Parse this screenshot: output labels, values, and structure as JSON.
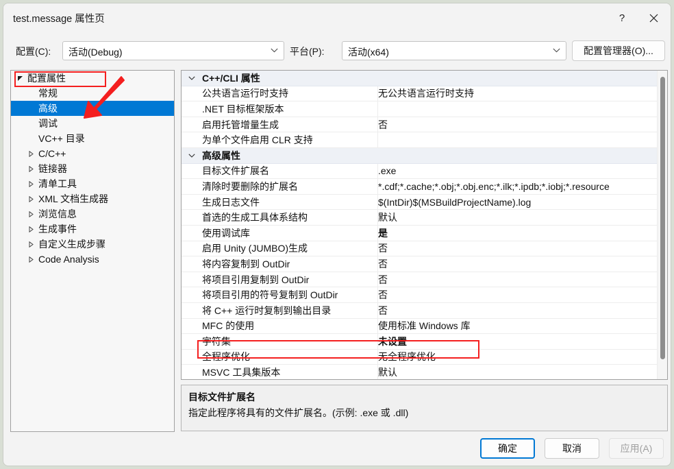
{
  "window": {
    "title": "test.message 属性页",
    "help_icon": "question-mark-icon",
    "close_icon": "close-icon"
  },
  "config_bar": {
    "config_label": "配置(C):",
    "config_value": "活动(Debug)",
    "platform_label": "平台(P):",
    "platform_value": "活动(x64)",
    "config_manager_button": "配置管理器(O)..."
  },
  "tree": {
    "items": [
      {
        "label": "配置属性",
        "depth": 0,
        "expander": "expanded",
        "selected": false
      },
      {
        "label": "常规",
        "depth": 1,
        "expander": "none",
        "selected": false
      },
      {
        "label": "高级",
        "depth": 1,
        "expander": "none",
        "selected": true
      },
      {
        "label": "调试",
        "depth": 1,
        "expander": "none",
        "selected": false
      },
      {
        "label": "VC++ 目录",
        "depth": 1,
        "expander": "none",
        "selected": false
      },
      {
        "label": "C/C++",
        "depth": 1,
        "expander": "collapsed",
        "selected": false
      },
      {
        "label": "链接器",
        "depth": 1,
        "expander": "collapsed",
        "selected": false
      },
      {
        "label": "清单工具",
        "depth": 1,
        "expander": "collapsed",
        "selected": false
      },
      {
        "label": "XML 文档生成器",
        "depth": 1,
        "expander": "collapsed",
        "selected": false
      },
      {
        "label": "浏览信息",
        "depth": 1,
        "expander": "collapsed",
        "selected": false
      },
      {
        "label": "生成事件",
        "depth": 1,
        "expander": "collapsed",
        "selected": false
      },
      {
        "label": "自定义生成步骤",
        "depth": 1,
        "expander": "collapsed",
        "selected": false
      },
      {
        "label": "Code Analysis",
        "depth": 1,
        "expander": "collapsed",
        "selected": false
      }
    ]
  },
  "grid": {
    "rows": [
      {
        "kind": "category",
        "name": "C++/CLI 属性",
        "value": "",
        "bold": false
      },
      {
        "kind": "property",
        "name": "公共语言运行时支持",
        "value": "无公共语言运行时支持",
        "bold": false
      },
      {
        "kind": "property",
        "name": ".NET 目标框架版本",
        "value": "",
        "bold": false
      },
      {
        "kind": "property",
        "name": "启用托管增量生成",
        "value": "否",
        "bold": false
      },
      {
        "kind": "property",
        "name": "为单个文件启用 CLR 支持",
        "value": "",
        "bold": false
      },
      {
        "kind": "category",
        "name": "高级属性",
        "value": "",
        "bold": false
      },
      {
        "kind": "property",
        "name": "目标文件扩展名",
        "value": ".exe",
        "bold": false
      },
      {
        "kind": "property",
        "name": "清除时要删除的扩展名",
        "value": "*.cdf;*.cache;*.obj;*.obj.enc;*.ilk;*.ipdb;*.iobj;*.resource",
        "bold": false
      },
      {
        "kind": "property",
        "name": "生成日志文件",
        "value": "$(IntDir)$(MSBuildProjectName).log",
        "bold": false
      },
      {
        "kind": "property",
        "name": "首选的生成工具体系结构",
        "value": "默认",
        "bold": false
      },
      {
        "kind": "property",
        "name": "使用调试库",
        "value": "是",
        "bold": true
      },
      {
        "kind": "property",
        "name": "启用 Unity (JUMBO)生成",
        "value": "否",
        "bold": false
      },
      {
        "kind": "property",
        "name": "将内容复制到 OutDir",
        "value": "否",
        "bold": false
      },
      {
        "kind": "property",
        "name": "将项目引用复制到 OutDir",
        "value": "否",
        "bold": false
      },
      {
        "kind": "property",
        "name": "将项目引用的符号复制到 OutDir",
        "value": "否",
        "bold": false
      },
      {
        "kind": "property",
        "name": "将 C++ 运行时复制到输出目录",
        "value": "否",
        "bold": false
      },
      {
        "kind": "property",
        "name": "MFC 的使用",
        "value": "使用标准 Windows 库",
        "bold": false
      },
      {
        "kind": "property",
        "name": "字符集",
        "value": "未设置",
        "bold": true
      },
      {
        "kind": "property",
        "name": "全程序优化",
        "value": "无全程序优化",
        "bold": false
      },
      {
        "kind": "property",
        "name": "MSVC 工具集版本",
        "value": "默认",
        "bold": false
      }
    ]
  },
  "description": {
    "title": "目标文件扩展名",
    "body": "指定此程序将具有的文件扩展名。(示例: .exe 或 .dll)"
  },
  "buttons": {
    "ok": "确定",
    "cancel": "取消",
    "apply": "应用(A)"
  },
  "colors": {
    "selection": "#0078d4",
    "annotation": "#f41f1f",
    "category_bg": "#eef1f6",
    "window_bg": "#f3f3f3"
  }
}
